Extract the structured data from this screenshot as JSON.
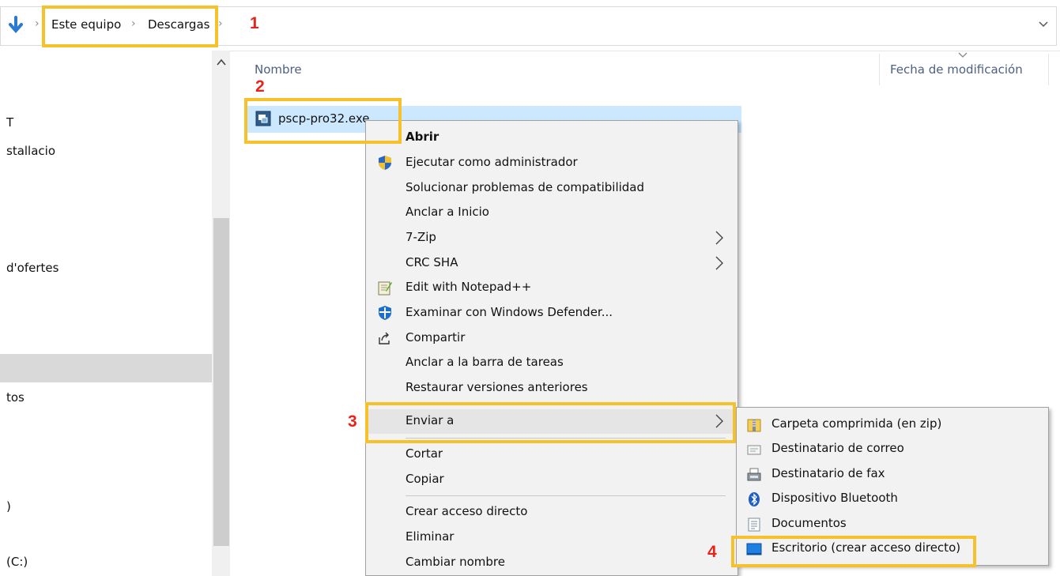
{
  "address_bar": {
    "breadcrumb": [
      "Este equipo",
      "Descargas"
    ],
    "separator": "›"
  },
  "nav_pane": {
    "items": [
      "T",
      "stallacio",
      "d'ofertes",
      "tos",
      ")",
      "(C:)"
    ]
  },
  "file_list": {
    "columns": [
      "Nombre",
      "Fecha de modificación"
    ],
    "files": [
      {
        "name": "pscp-pro32.exe"
      }
    ]
  },
  "context_menu": {
    "items": [
      {
        "label": "Abrir",
        "bold": true
      },
      {
        "label": "Ejecutar como administrador",
        "icon": "shield-icon"
      },
      {
        "label": "Solucionar problemas de compatibilidad"
      },
      {
        "label": "Anclar a Inicio"
      },
      {
        "label": "7-Zip",
        "submenu": true
      },
      {
        "label": "CRC SHA",
        "submenu": true
      },
      {
        "label": "Edit with Notepad++",
        "icon": "notepad-icon"
      },
      {
        "label": "Examinar con Windows Defender...",
        "icon": "defender-icon"
      },
      {
        "label": "Compartir",
        "icon": "share-icon"
      },
      {
        "label": "Anclar a la barra de tareas"
      },
      {
        "label": "Restaurar versiones anteriores"
      },
      {
        "label": "Enviar a",
        "submenu": true,
        "highlighted": true
      },
      {
        "label": "Cortar"
      },
      {
        "label": "Copiar"
      },
      {
        "label": "Crear acceso directo"
      },
      {
        "label": "Eliminar"
      },
      {
        "label": "Cambiar nombre"
      }
    ]
  },
  "send_to_menu": {
    "items": [
      {
        "label": "Carpeta comprimida (en zip)",
        "icon": "zip-folder-icon"
      },
      {
        "label": "Destinatario de correo",
        "icon": "mail-icon"
      },
      {
        "label": "Destinatario de fax",
        "icon": "fax-icon"
      },
      {
        "label": "Dispositivo Bluetooth",
        "icon": "bluetooth-icon"
      },
      {
        "label": "Documentos",
        "icon": "documents-icon"
      },
      {
        "label": "Escritorio (crear acceso directo)",
        "icon": "desktop-icon",
        "highlighted": true
      }
    ]
  },
  "annotations": [
    "1",
    "2",
    "3",
    "4"
  ],
  "colors": {
    "annotation_box": "#f6c12a",
    "annotation_number": "#e8231a",
    "selection": "#cce8ff",
    "menu_bg": "#f2f2f2"
  }
}
